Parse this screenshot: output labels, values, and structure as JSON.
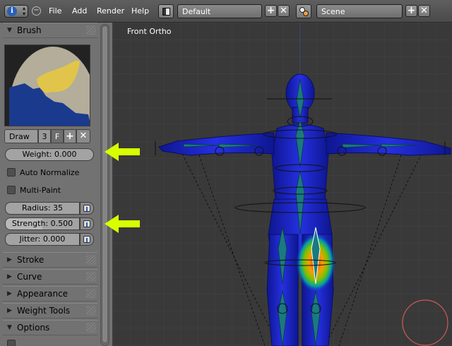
{
  "header": {
    "menus": [
      "File",
      "Add",
      "Render",
      "Help"
    ],
    "screen_layout": "Default",
    "scene": "Scene"
  },
  "panel": {
    "brush_section": "Brush",
    "brush_name": "Draw",
    "brush_users": "3",
    "fake_user": "F",
    "weight": "Weight: 0.000",
    "auto_normalize": "Auto Normalize",
    "multi_paint": "Multi-Paint",
    "radius": "Radius: 35",
    "strength": "Strength: 0.500",
    "strength_fraction": 0.5,
    "jitter": "Jitter: 0.000",
    "sections": [
      "Stroke",
      "Curve",
      "Appearance",
      "Weight Tools",
      "Options"
    ]
  },
  "viewport": {
    "label": "Front Ortho"
  },
  "colors": {
    "arrow": "#d8ff00",
    "mesh_blue": "#1a22c8",
    "cursor_ring": "#d05a5a"
  }
}
